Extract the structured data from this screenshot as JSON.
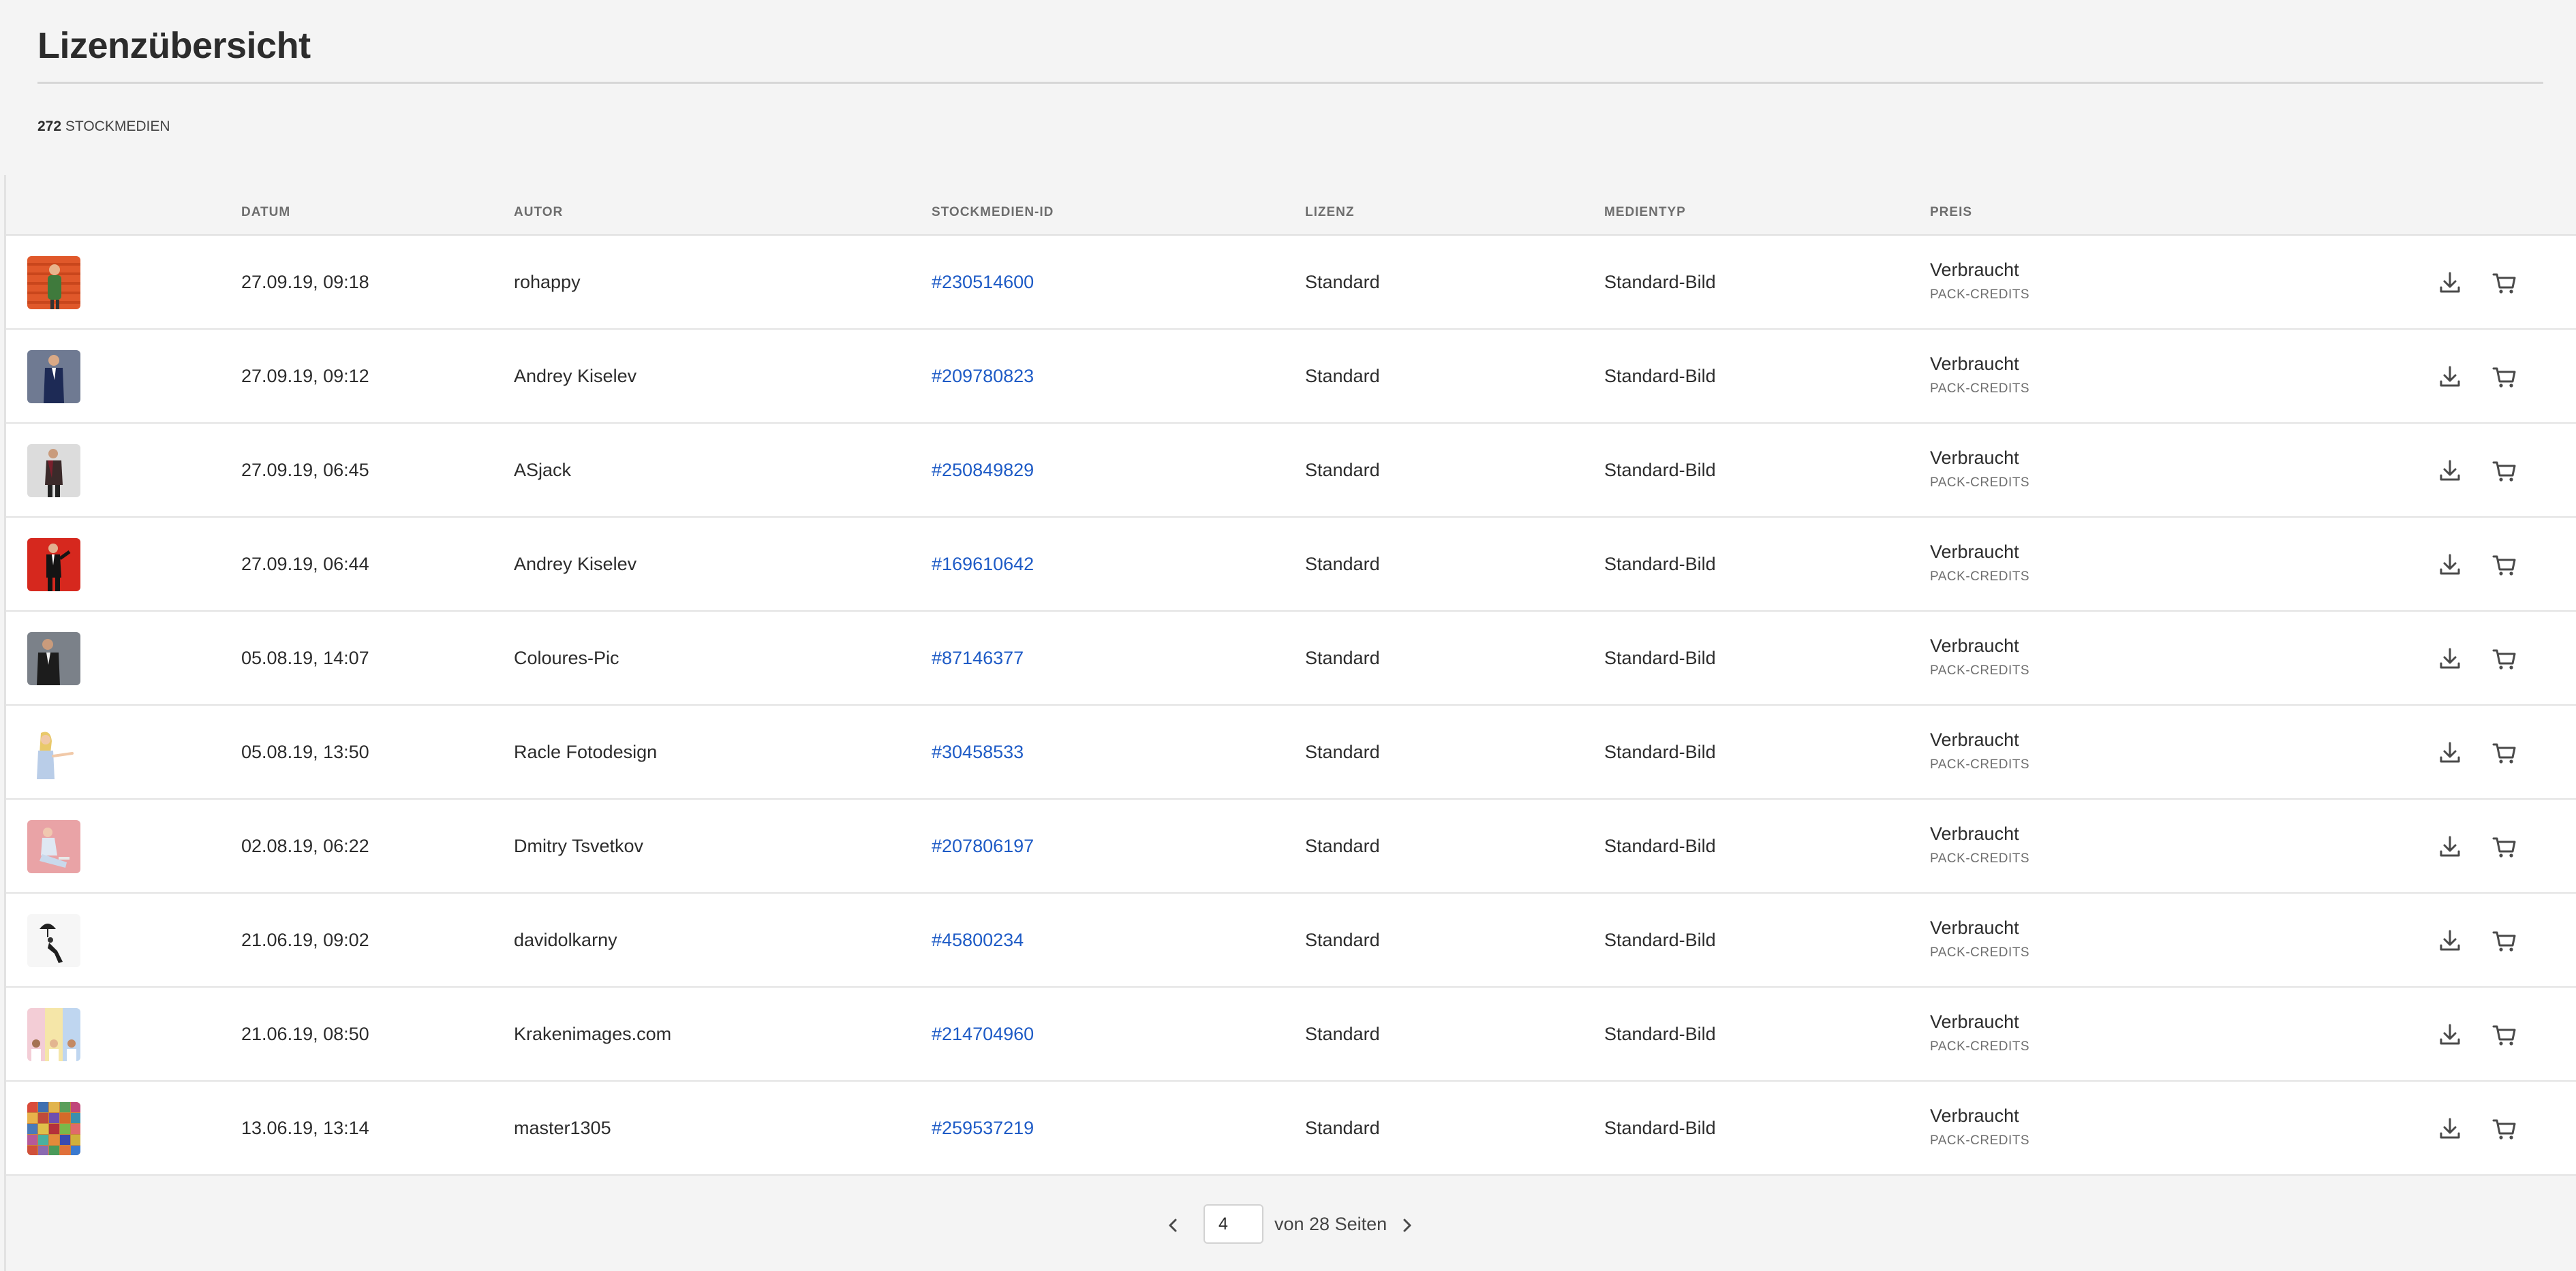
{
  "page": {
    "title": "Lizenzübersicht",
    "count_number": "272",
    "count_label": "STOCKMEDIEN"
  },
  "table": {
    "headers": {
      "datum": "DATUM",
      "autor": "AUTOR",
      "id": "STOCKMEDIEN-ID",
      "lizenz": "LIZENZ",
      "medientyp": "MEDIENTYP",
      "preis": "PREIS"
    },
    "rows": [
      {
        "datum": "27.09.19, 09:18",
        "autor": "rohappy",
        "id": "#230514600",
        "lizenz": "Standard",
        "medientyp": "Standard-Bild",
        "preis": "Verbraucht",
        "preis_sub": "PACK-CREDITS",
        "thumb": "man-orange-bg"
      },
      {
        "datum": "27.09.19, 09:12",
        "autor": "Andrey Kiselev",
        "id": "#209780823",
        "lizenz": "Standard",
        "medientyp": "Standard-Bild",
        "preis": "Verbraucht",
        "preis_sub": "PACK-CREDITS",
        "thumb": "man-suit-grey-bg"
      },
      {
        "datum": "27.09.19, 06:45",
        "autor": "ASjack",
        "id": "#250849829",
        "lizenz": "Standard",
        "medientyp": "Standard-Bild",
        "preis": "Verbraucht",
        "preis_sub": "PACK-CREDITS",
        "thumb": "man-light-bg"
      },
      {
        "datum": "27.09.19, 06:44",
        "autor": "Andrey Kiselev",
        "id": "#169610642",
        "lizenz": "Standard",
        "medientyp": "Standard-Bild",
        "preis": "Verbraucht",
        "preis_sub": "PACK-CREDITS",
        "thumb": "man-red-bg"
      },
      {
        "datum": "05.08.19, 14:07",
        "autor": "Coloures-Pic",
        "id": "#87146377",
        "lizenz": "Standard",
        "medientyp": "Standard-Bild",
        "preis": "Verbraucht",
        "preis_sub": "PACK-CREDITS",
        "thumb": "man-dark-grey-bg"
      },
      {
        "datum": "05.08.19, 13:50",
        "autor": "Racle Fotodesign",
        "id": "#30458533",
        "lizenz": "Standard",
        "medientyp": "Standard-Bild",
        "preis": "Verbraucht",
        "preis_sub": "PACK-CREDITS",
        "thumb": "woman-white-bg"
      },
      {
        "datum": "02.08.19, 06:22",
        "autor": "Dmitry Tsvetkov",
        "id": "#207806197",
        "lizenz": "Standard",
        "medientyp": "Standard-Bild",
        "preis": "Verbraucht",
        "preis_sub": "PACK-CREDITS",
        "thumb": "woman-pink-bg"
      },
      {
        "datum": "21.06.19, 09:02",
        "autor": "davidolkarny",
        "id": "#45800234",
        "lizenz": "Standard",
        "medientyp": "Standard-Bild",
        "preis": "Verbraucht",
        "preis_sub": "PACK-CREDITS",
        "thumb": "man-umbrella-white-bg"
      },
      {
        "datum": "21.06.19, 08:50",
        "autor": "Krakenimages.com",
        "id": "#214704960",
        "lizenz": "Standard",
        "medientyp": "Standard-Bild",
        "preis": "Verbraucht",
        "preis_sub": "PACK-CREDITS",
        "thumb": "group-pastel-bg"
      },
      {
        "datum": "13.06.19, 13:14",
        "autor": "master1305",
        "id": "#259537219",
        "lizenz": "Standard",
        "medientyp": "Standard-Bild",
        "preis": "Verbraucht",
        "preis_sub": "PACK-CREDITS",
        "thumb": "collage-portraits"
      }
    ]
  },
  "actions": {
    "download_icon": "download-icon",
    "cart_icon": "cart-icon"
  },
  "pagination": {
    "current_page": "4",
    "label": "von 28 Seiten",
    "prev_icon": "chevron-left-icon",
    "next_icon": "chevron-right-icon"
  },
  "colors": {
    "link": "#1e5bc6",
    "background": "#f4f4f4",
    "row_background": "#ffffff"
  }
}
